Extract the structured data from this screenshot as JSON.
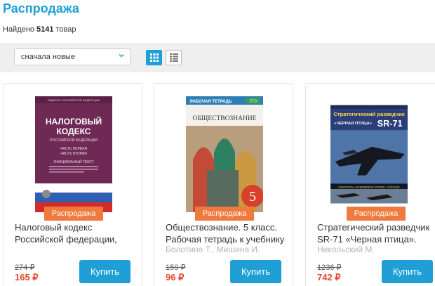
{
  "page": {
    "title": "Распродажа",
    "found_prefix": "Найдено",
    "found_count": "5141",
    "found_suffix": "товар"
  },
  "toolbar": {
    "sort_value": "сначала новые"
  },
  "colors": {
    "accent": "#1f9fd6",
    "sale_badge": "#f07a3d",
    "price": "#e2482b"
  },
  "products": [
    {
      "badge": "Распродажа",
      "title": "Налоговый кодекс Российской федерации,",
      "author": "",
      "old_price": "274 ₽",
      "new_price": "165 ₽",
      "buy_label": "Купить",
      "cover": {
        "header": "КОДЕКСЫ РОССИЙСКОЙ ФЕДЕРАЦИИ",
        "line1": "НАЛОГОВЫЙ",
        "line2": "КОДЕКС",
        "line3": "РОССИЙСКОЙ ФЕДЕРАЦИИ",
        "line4": "ЧАСТЬ ПЕРВАЯ",
        "line5": "ЧАСТЬ ВТОРАЯ",
        "line6": "ОФИЦИАЛЬНЫЙ ТЕКСТ"
      }
    },
    {
      "badge": "Распродажа",
      "title": "Обществознание. 5 класс. Рабочая тетрадь к учебнику",
      "author": "Болотина Т., Мишина И.",
      "old_price": "159 ₽",
      "new_price": "96 ₽",
      "buy_label": "Купить",
      "cover": {
        "top": "РАБОЧАЯ ТЕТРАДЬ",
        "subject": "ОБЩЕСТВОЗНАНИЕ",
        "grade": "5",
        "tag": "ЕГЭ"
      }
    },
    {
      "badge": "Распродажа",
      "title": "Стратегический разведчик SR-71 «Черная птица».",
      "author": "Никольский М.",
      "old_price": "1236 ₽",
      "new_price": "742 ₽",
      "buy_label": "Купить",
      "cover": {
        "line1": "Стратегический разведчик",
        "line2": "«ЧЕРНАЯ ПТИЦА»",
        "line3": "SR-71",
        "bottom": "САМОЛЕТЫ «НЕВИДИМКИ» ФИРМЫ «ЛОКХИД»"
      }
    }
  ]
}
